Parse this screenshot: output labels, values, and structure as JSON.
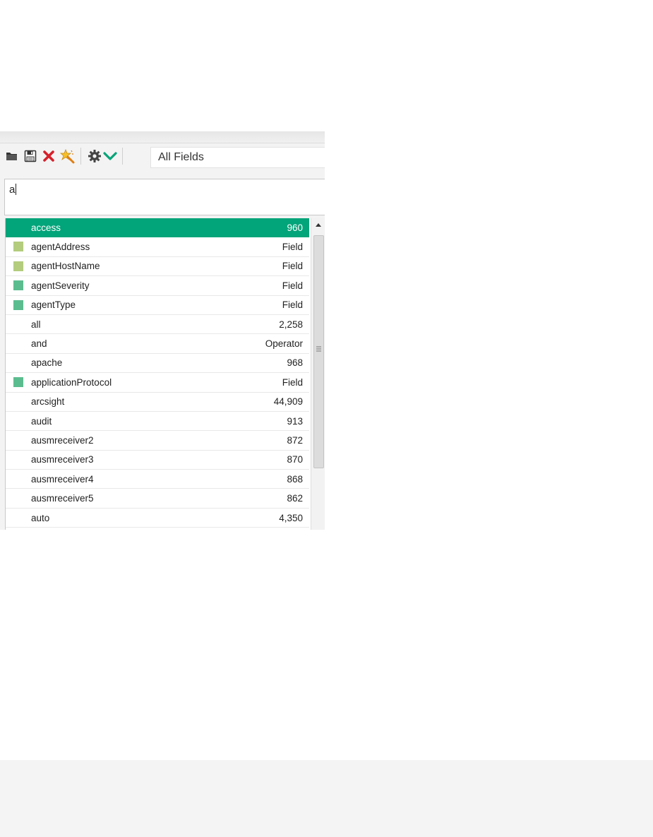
{
  "toolbar": {
    "icons": [
      "folder-icon",
      "save-icon",
      "delete-icon",
      "new-icon",
      "gear-icon",
      "chevron-down-icon"
    ],
    "field_select": "All Fields"
  },
  "query": {
    "value": "a"
  },
  "colors": {
    "selected": "#02a479",
    "field_light": "#b3cc7e",
    "field_teal": "#5bbd8f"
  },
  "suggestions": [
    {
      "label": "access",
      "value": "960",
      "swatch": null,
      "selected": true
    },
    {
      "label": "agentAddress",
      "value": "Field",
      "swatch": "#b3cc7e"
    },
    {
      "label": "agentHostName",
      "value": "Field",
      "swatch": "#b3cc7e"
    },
    {
      "label": "agentSeverity",
      "value": "Field",
      "swatch": "#5bbd8f"
    },
    {
      "label": "agentType",
      "value": "Field",
      "swatch": "#5bbd8f"
    },
    {
      "label": "all",
      "value": "2,258",
      "swatch": null
    },
    {
      "label": "and",
      "value": "Operator",
      "swatch": null
    },
    {
      "label": "apache",
      "value": "968",
      "swatch": null
    },
    {
      "label": "applicationProtocol",
      "value": "Field",
      "swatch": "#5bbd8f"
    },
    {
      "label": "arcsight",
      "value": "44,909",
      "swatch": null
    },
    {
      "label": "audit",
      "value": "913",
      "swatch": null
    },
    {
      "label": "ausmreceiver2",
      "value": "872",
      "swatch": null
    },
    {
      "label": "ausmreceiver3",
      "value": "870",
      "swatch": null
    },
    {
      "label": "ausmreceiver4",
      "value": "868",
      "swatch": null
    },
    {
      "label": "ausmreceiver5",
      "value": "862",
      "swatch": null
    },
    {
      "label": "auto",
      "value": "4,350",
      "swatch": null
    }
  ]
}
